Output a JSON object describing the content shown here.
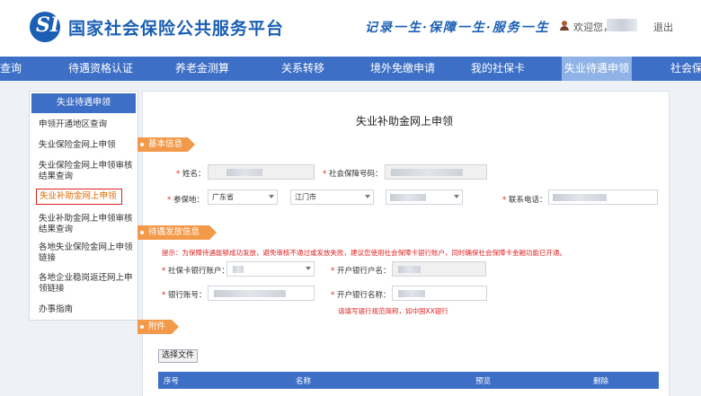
{
  "header": {
    "site_title": "国家社会保险公共服务平台",
    "slogan": "记录一生·保障一生·服务一生",
    "welcome": "欢迎您，",
    "logout": "退出"
  },
  "nav": {
    "items": [
      "查询",
      "待遇资格认证",
      "养老金测算",
      "关系转移",
      "境外免缴申请",
      "我的社保卡",
      "失业待遇申领",
      "社会保"
    ],
    "active_index": 6
  },
  "sidebar": {
    "heading": "失业待遇申领",
    "items": [
      "申领开通地区查询",
      "失业保险金网上申领",
      "失业保险金网上申领审核结果查询",
      "失业补助金网上申领",
      "失业补助金网上申领审核结果查询",
      "各地失业保险金网上申领链接",
      "各地企业稳岗返还网上申领链接",
      "办事指南"
    ],
    "current_index": 3
  },
  "form": {
    "title": "失业补助金网上申领",
    "sections": {
      "basic": "基本信息",
      "payout": "待遇发放信息",
      "attachment": "附件"
    },
    "labels": {
      "name": "姓名：",
      "ssn": "社会保障号码：",
      "insured_place": "参保地：",
      "phone": "联系电话：",
      "card_account": "社保卡银行账户：",
      "account_holder": "开户银行户名：",
      "bank_account": "银行账号：",
      "bank_name": "开户银行名称："
    },
    "values": {
      "province": "广东省",
      "city": "江门市"
    },
    "hints": {
      "payout": "提示：为保障待遇能够成功发放，避免审核不通过或发放失败，建议您使用社会保障卡银行账户，同时确保社会保障卡金融功能已开通。",
      "bank_name": "请填写银行规范简称，如中国XX银行"
    },
    "file_button": "选择文件",
    "table_headers": [
      "序号",
      "名称",
      "预览",
      "删除"
    ]
  },
  "colors": {
    "brand_blue": "#1a5fb4",
    "nav_blue": "#3d6fc6",
    "nav_active": "#8fb3e6",
    "section_orange": "#f39a4a",
    "highlight_red": "#e02020"
  }
}
